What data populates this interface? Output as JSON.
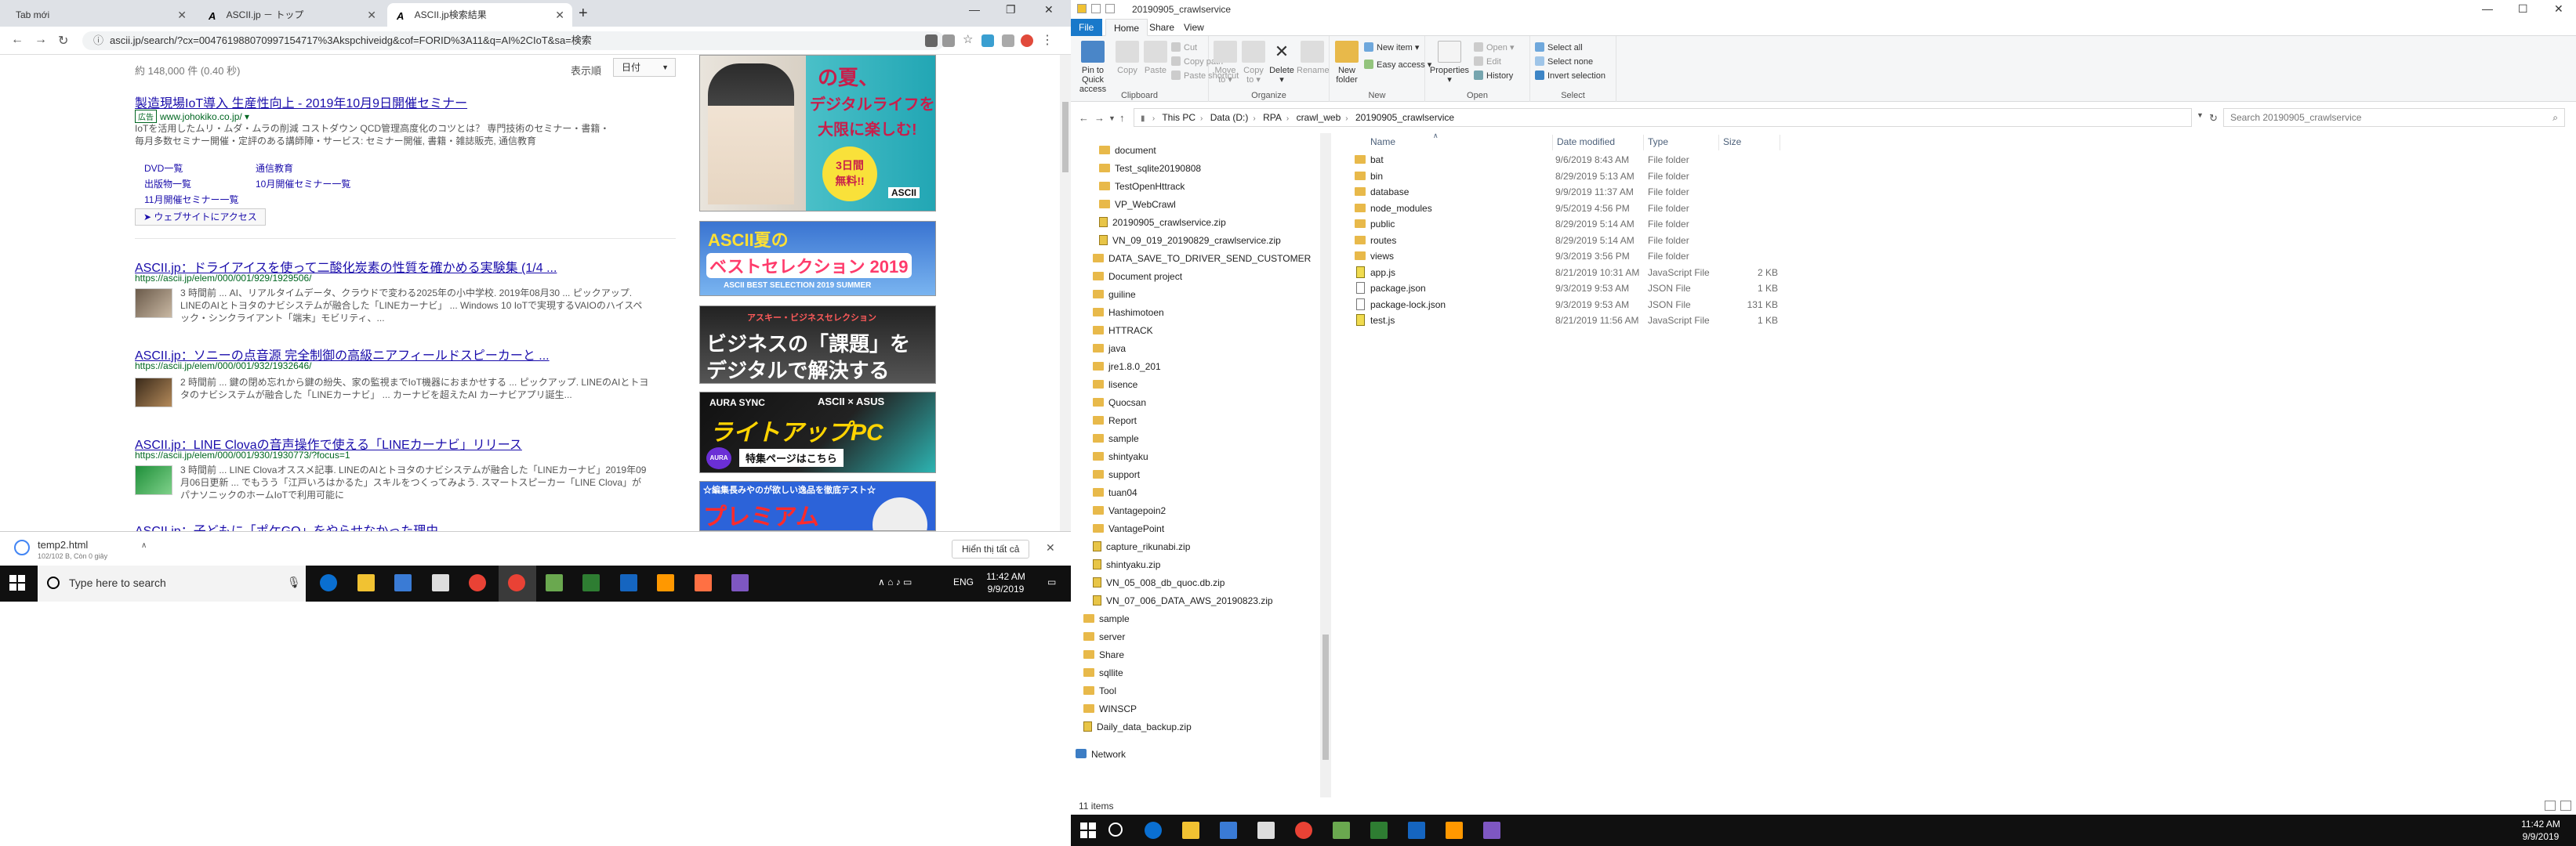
{
  "chrome": {
    "tabs": [
      {
        "title": "Tab mới"
      },
      {
        "title": "ASCII.jp － トップ"
      },
      {
        "title": "ASCII.jp検索結果"
      }
    ],
    "new_tab": "+",
    "omnibox_url": "ascii.jp/search/?cx=004761988070997154717%3Akspchiveidg&cof=FORID%3A11&q=AI%2CIoT&sa=検索"
  },
  "search": {
    "result_count": "約 148,000 件 (0.40 秒)",
    "sort_label": "表示順",
    "sort_value": "日付"
  },
  "ad": {
    "title": "製造現場IoT導入 生産性向上 - 2019年10月9日開催セミナー",
    "badge": "広告",
    "url": "www.johokiko.co.jp/ ▾",
    "desc": "IoTを活用したムリ・ムダ・ムラの削減 コストダウン QCD管理高度化のコツとは？ 専門技術のセミナー・書籍・毎月多数セミナー開催・定評のある講師陣・サービス: セミナー開催, 書籍・雑誌販売, 通信教育",
    "sitelinks": [
      "DVD一覧",
      "通信教育",
      "出版物一覧",
      "10月開催セミナー一覧",
      "11月開催セミナー一覧"
    ],
    "website_button": "➤ ウェブサイトにアクセス"
  },
  "results": [
    {
      "title": "ASCII.jp：ドライアイスを使って二酸化炭素の性質を確かめる実験集 (1/4 ...",
      "url": "https://ascii.jp/elem/000/001/929/1929506/",
      "snippet": "3 時間前 ... AI、リアルタイムデータ、クラウドで変わる2025年の小中学校. 2019年08月30 ... ピックアップ. LINEのAIとトヨタのナビシステムが融合した「LINEカーナビ」 ... Windows 10 IoTで実現するVAIOのハイスペック・シンクライアント「端末」モビリティ、..."
    },
    {
      "title": "ASCII.jp：ソニーの点音源 完全制御の高級ニアフィールドスピーカーと ...",
      "url": "https://ascii.jp/elem/000/001/932/1932646/",
      "snippet": "2 時間前 ... 鍵の閉め忘れから鍵の紛失、家の監視までIoT機器におまかせする ... ピックアップ. LINEのAIとトヨタのナビシステムが融合した「LINEカーナビ」 ... カーナビを超えたAI カーナビアプリ誕生..."
    },
    {
      "title": "ASCII.jp：LINE Clovaの音声操作で使える「LINEカーナビ」リリース",
      "url": "https://ascii.jp/elem/000/001/930/1930773/?focus=1",
      "snippet": "3 時間前 ... LINE Clovaオススメ記事. LINEのAIとトヨタのナビシステムが融合した「LINEカーナビ」2019年09月06日更新 ... でもうう「江戸いろはかるた」スキルをつくってみよう. スマートスピーカー「LINE Clova」がパナソニックのホームIoTで利用可能に"
    },
    {
      "title": "ASCII.jp：子どもに「ポケGO」をやらせなかった理由"
    }
  ],
  "banners": {
    "b1_lines": [
      "の夏、",
      "デジタルライフを",
      "大限に楽しむ!",
      "3日間",
      "無料!!",
      "ASCII"
    ],
    "b2_lines": [
      "ASCII夏の",
      "ベストセレクション 2019",
      "ASCII BEST SELECTION 2019 SUMMER"
    ],
    "b3_lines": [
      "アスキー・ビジネスセレクション",
      "ビジネスの「課題」を",
      "デジタルで解決する"
    ],
    "b4_lines": [
      "AURA SYNC",
      "ASCII × ASUS",
      "ライトアップPC",
      "特集ページはこちら",
      "AURA"
    ],
    "b5_lines": [
      "☆編集長みやのが欲しい逸品を徹底テスト☆",
      "プレミアム"
    ]
  },
  "download_bar": {
    "file": "temp2.html",
    "sub": "102/102 B, Còn 0 giây",
    "show_all": "Hiển thị tất cả"
  },
  "taskbar_left": {
    "search_placeholder": "Type here to search",
    "lang": "ENG",
    "time": "11:42 AM",
    "date": "9/9/2019"
  },
  "explorer": {
    "title": "20190905_crawlservice",
    "ribbon_tabs": [
      "File",
      "Home",
      "Share",
      "View"
    ],
    "ribbon": {
      "clipboard": {
        "label": "Clipboard",
        "pin": "Pin to Quick access",
        "copy": "Copy",
        "paste": "Paste",
        "cut": "Cut",
        "copy_path": "Copy path",
        "paste_shortcut": "Paste shortcut"
      },
      "organize": {
        "label": "Organize",
        "move_to": "Move to ▾",
        "copy_to": "Copy to ▾",
        "delete": "Delete ▾",
        "rename": "Rename"
      },
      "new": {
        "label": "New",
        "new_folder": "New folder",
        "new_item": "New item ▾",
        "easy_access": "Easy access ▾"
      },
      "open": {
        "label": "Open",
        "properties": "Properties ▾",
        "open": "Open ▾",
        "edit": "Edit",
        "history": "History"
      },
      "select": {
        "label": "Select",
        "select_all": "Select all",
        "select_none": "Select none",
        "invert": "Invert selection"
      }
    },
    "breadcrumb": [
      "This PC",
      "Data (D:)",
      "RPA",
      "crawl_web",
      "20190905_crawlservice"
    ],
    "search_placeholder": "Search 20190905_crawlservice",
    "nav_tree": [
      "document",
      "Test_sqlite20190808",
      "TestOpenHttrack",
      "VP_WebCrawl",
      "20190905_crawlservice.zip",
      "VN_09_019_20190829_crawlservice.zip",
      "DATA_SAVE_TO_DRIVER_SEND_CUSTOMER",
      "Document project",
      "guiline",
      "Hashimotoen",
      "HTTRACK",
      "java",
      "jre1.8.0_201",
      "lisence",
      "Quocsan",
      "Report",
      "sample",
      "shintyaku",
      "support",
      "tuan04",
      "Vantagepoin2",
      "VantagePoint",
      "capture_rikunabi.zip",
      "shintyaku.zip",
      "VN_05_008_db_quoc.db.zip",
      "VN_07_006_DATA_AWS_20190823.zip",
      "sample",
      "server",
      "Share",
      "sqllite",
      "Tool",
      "WINSCP",
      "Daily_data_backup.zip",
      "Network"
    ],
    "columns": [
      "Name",
      "Date modified",
      "Type",
      "Size"
    ],
    "files": [
      {
        "name": "bat",
        "date": "9/6/2019 8:43 AM",
        "type": "File folder",
        "size": "",
        "kind": "folder"
      },
      {
        "name": "bin",
        "date": "8/29/2019 5:13 AM",
        "type": "File folder",
        "size": "",
        "kind": "folder"
      },
      {
        "name": "database",
        "date": "9/9/2019 11:37 AM",
        "type": "File folder",
        "size": "",
        "kind": "folder"
      },
      {
        "name": "node_modules",
        "date": "9/5/2019 4:56 PM",
        "type": "File folder",
        "size": "",
        "kind": "folder"
      },
      {
        "name": "public",
        "date": "8/29/2019 5:14 AM",
        "type": "File folder",
        "size": "",
        "kind": "folder"
      },
      {
        "name": "routes",
        "date": "8/29/2019 5:14 AM",
        "type": "File folder",
        "size": "",
        "kind": "folder"
      },
      {
        "name": "views",
        "date": "9/3/2019 3:56 PM",
        "type": "File folder",
        "size": "",
        "kind": "folder"
      },
      {
        "name": "app.js",
        "date": "8/21/2019 10:31 AM",
        "type": "JavaScript File",
        "size": "2 KB",
        "kind": "js"
      },
      {
        "name": "package.json",
        "date": "9/3/2019 9:53 AM",
        "type": "JSON File",
        "size": "1 KB",
        "kind": "json"
      },
      {
        "name": "package-lock.json",
        "date": "9/3/2019 9:53 AM",
        "type": "JSON File",
        "size": "131 KB",
        "kind": "json"
      },
      {
        "name": "test.js",
        "date": "8/21/2019 11:56 AM",
        "type": "JavaScript File",
        "size": "1 KB",
        "kind": "js"
      }
    ],
    "status": "11 items"
  },
  "taskbar_right": {
    "time": "11:42 AM",
    "date": "9/9/2019"
  }
}
